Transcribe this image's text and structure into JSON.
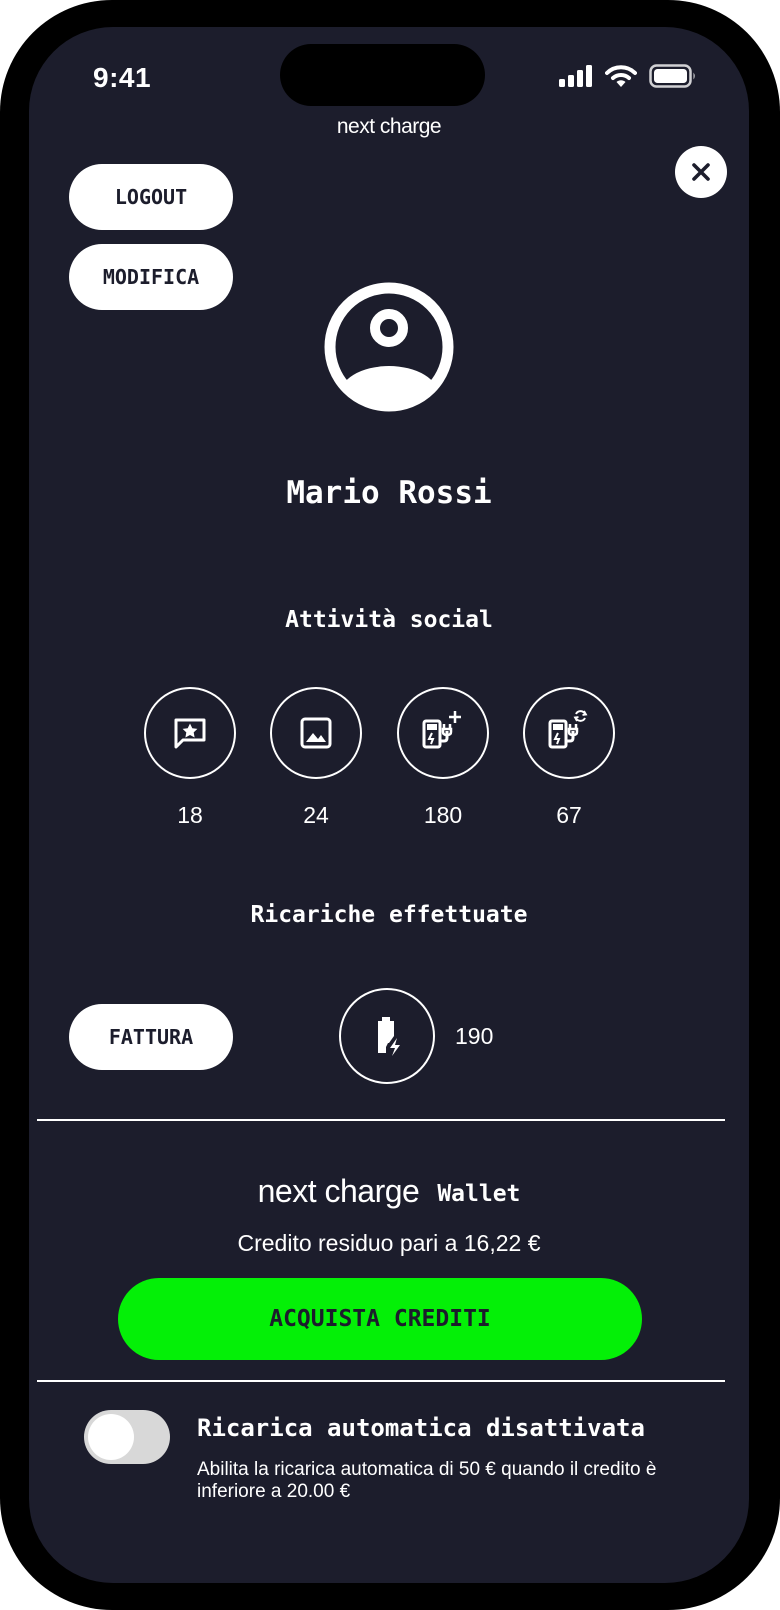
{
  "status_bar": {
    "time": "9:41"
  },
  "brand": {
    "name": "next charge"
  },
  "profile": {
    "logout_label": "LOGOUT",
    "edit_label": "MODIFICA",
    "user_name": "Mario Rossi"
  },
  "social": {
    "title": "Attività social",
    "stats": [
      {
        "icon": "review-star-icon",
        "count": "18"
      },
      {
        "icon": "image-icon",
        "count": "24"
      },
      {
        "icon": "charger-add-icon",
        "count": "180"
      },
      {
        "icon": "charger-sync-icon",
        "count": "67"
      }
    ]
  },
  "recharges": {
    "title": "Ricariche effettuate",
    "invoice_label": "FATTURA",
    "icon": "battery-charge-icon",
    "count": "190"
  },
  "wallet": {
    "brand": "next charge",
    "word": "Wallet",
    "credit_text": "Credito residuo pari a 16,22 €",
    "buy_label": "ACQUISTA CREDITI"
  },
  "auto_recharge": {
    "title": "Ricarica automatica disattivata",
    "description": "Abilita la ricarica automatica di 50 € quando il credito è inferiore a 20.00 €",
    "enabled": false
  },
  "colors": {
    "background": "#1c1d2c",
    "accent": "#04f007",
    "text": "#ffffff",
    "toggle_off": "#d8d8d8"
  }
}
